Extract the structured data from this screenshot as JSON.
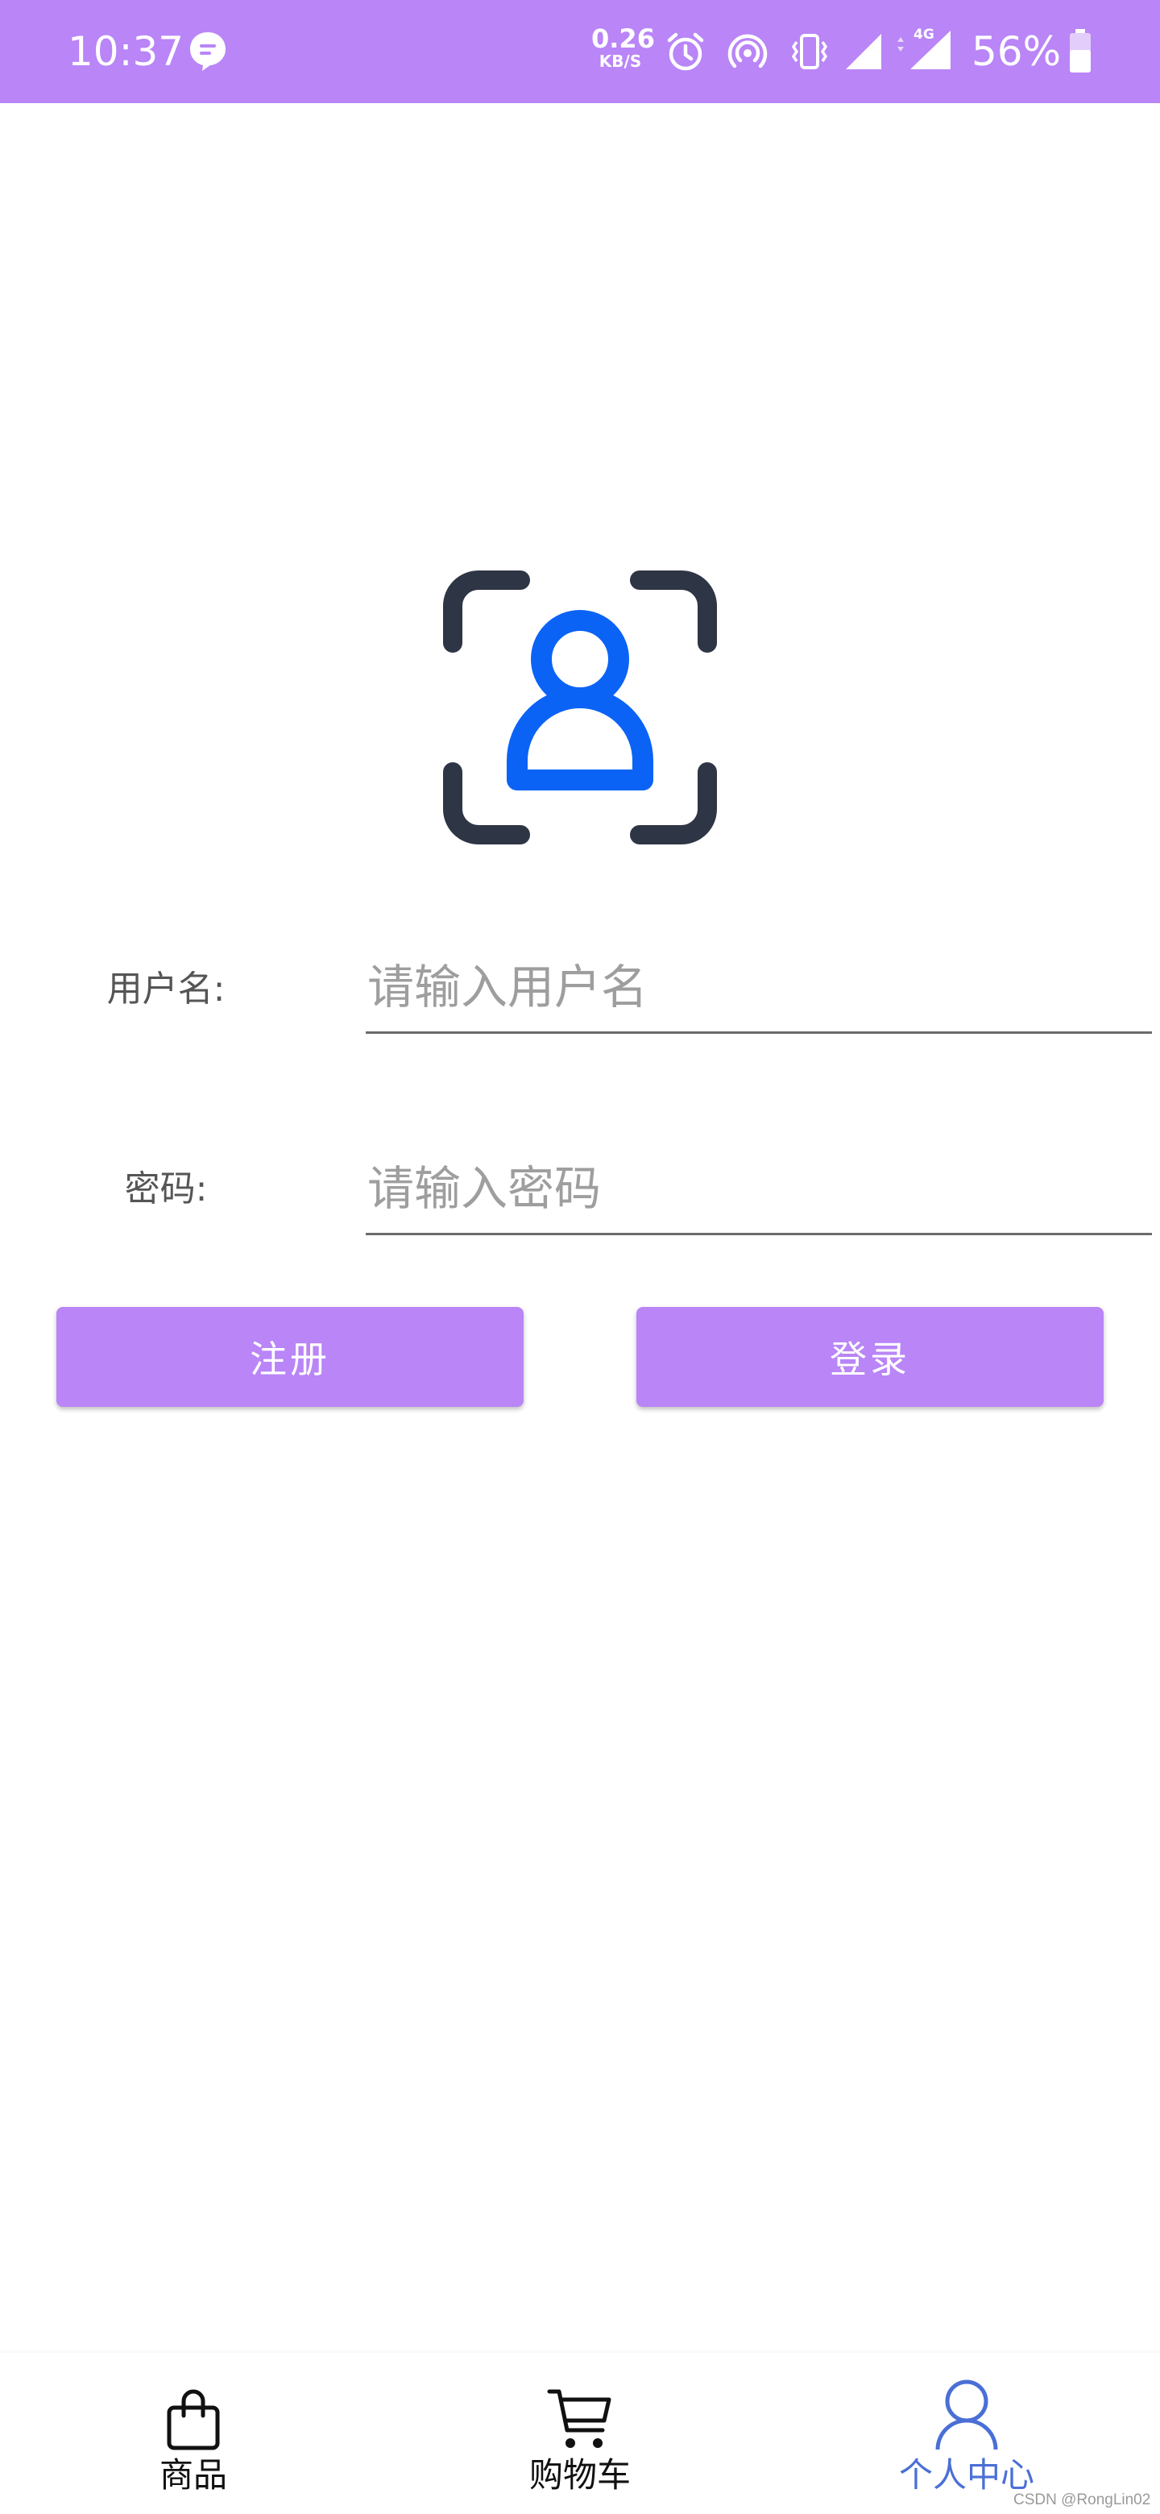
{
  "status_bar": {
    "time": "10:37",
    "net_speed_value": "0.26",
    "net_speed_unit": "KB/S",
    "network_type": "4G",
    "battery_percent": "56%",
    "icons": [
      "message-icon",
      "alarm-icon",
      "hotspot-icon",
      "vibrate-icon",
      "signal-icon",
      "signal-4g-icon",
      "battery-icon"
    ],
    "background_color": "#b985f7"
  },
  "logo": {
    "icon": "user-scan-icon",
    "frame_color": "#2e3545",
    "person_color": "#0b63f6"
  },
  "form": {
    "username_label": "用户名:",
    "username_placeholder": "请输入用户名",
    "username_value": "",
    "password_label": "密码:",
    "password_placeholder": "请输入密码",
    "password_value": ""
  },
  "buttons": {
    "register_label": "注册",
    "login_label": "登录",
    "color": "#b985f7"
  },
  "bottom_nav": {
    "items": [
      {
        "label": "商品",
        "icon": "shopping-bag-icon",
        "active": false
      },
      {
        "label": "购物车",
        "icon": "cart-icon",
        "active": false
      },
      {
        "label": "个人中心",
        "icon": "user-icon",
        "active": true
      }
    ],
    "active_color": "#4a6fd6"
  },
  "watermark": "CSDN @RongLin02"
}
